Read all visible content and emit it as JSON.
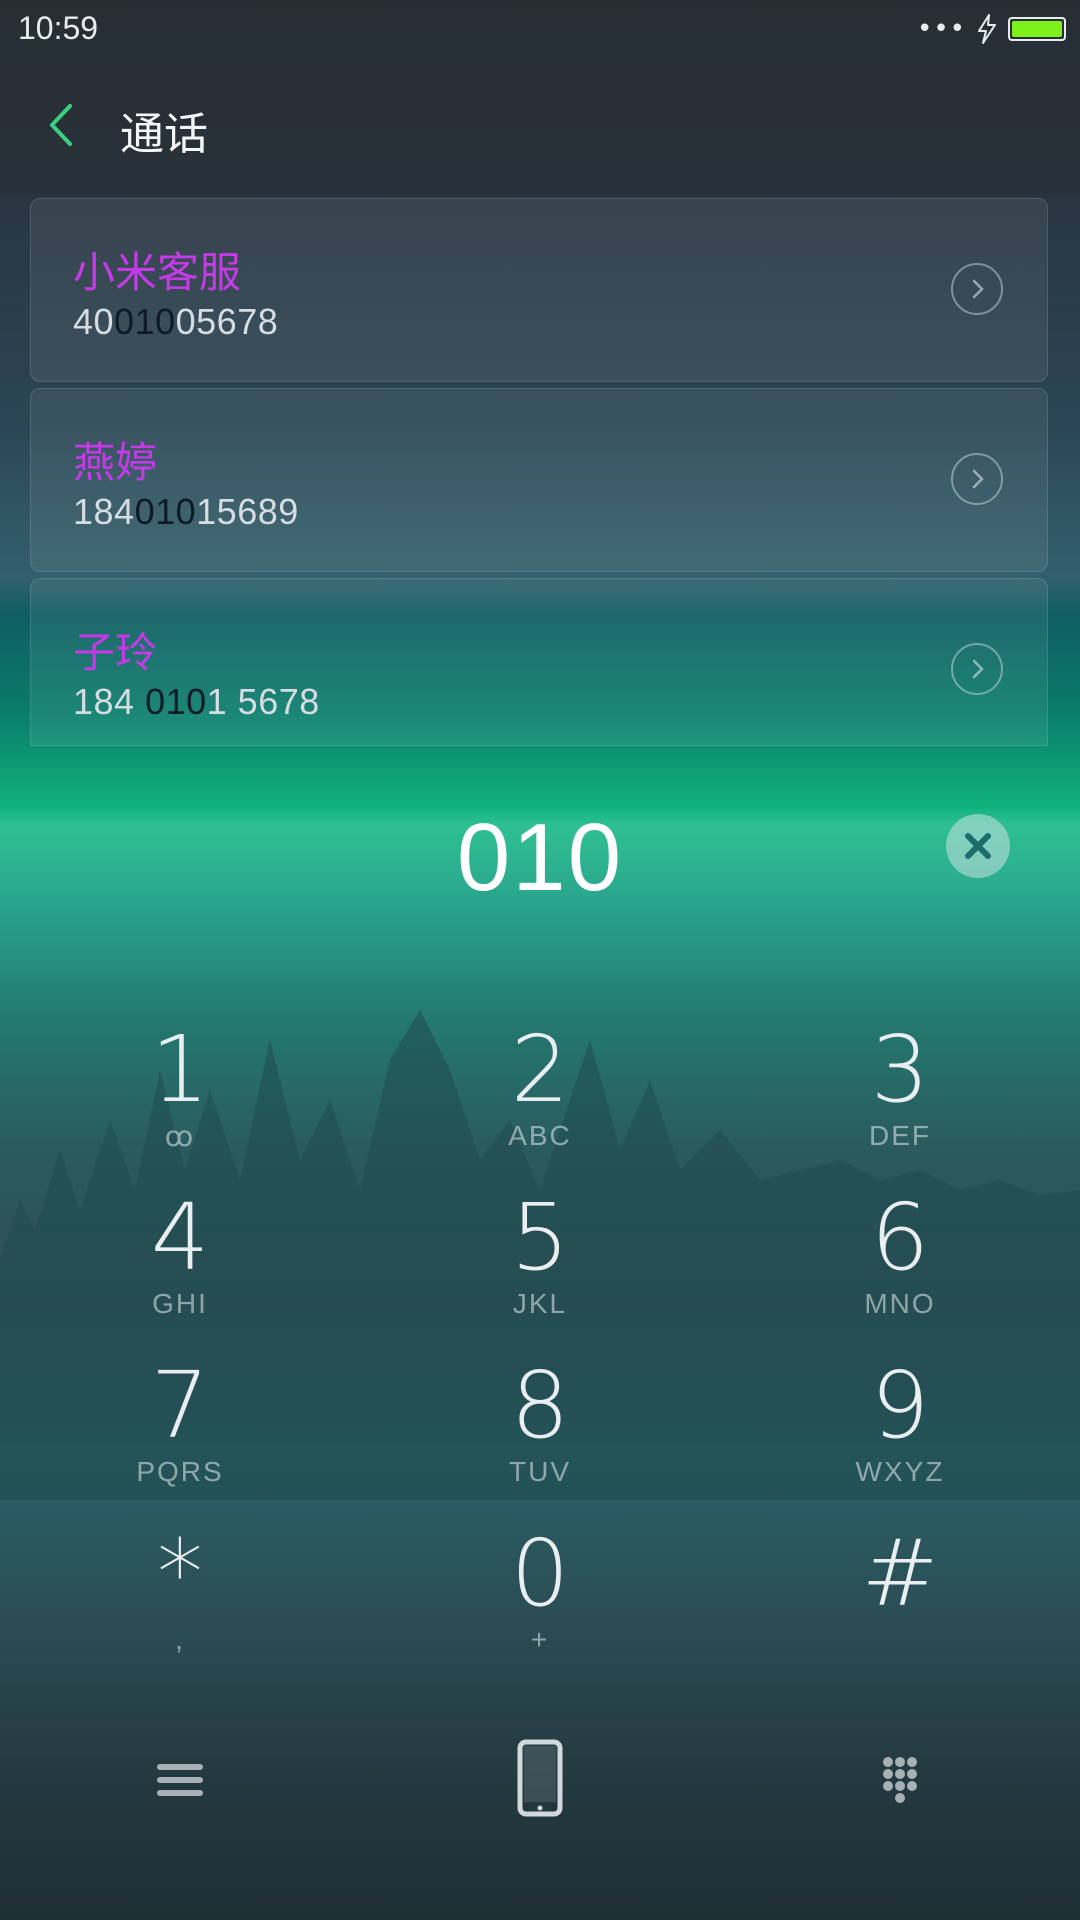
{
  "status_bar": {
    "time": "10:59",
    "signal_dots": "•••",
    "battery_color": "#7ff11a"
  },
  "header": {
    "title": "通话",
    "back_icon": "chevron-left-icon",
    "accent_color": "#3ad07f"
  },
  "contacts": [
    {
      "name": "小米客服",
      "number_pre": "40",
      "number_hl": "010",
      "number_post": "05678"
    },
    {
      "name": "燕婷",
      "number_pre": "184",
      "number_hl": "010",
      "number_post": "15689"
    },
    {
      "name": "子玲",
      "number_pre": "184 ",
      "number_hl": "010",
      "number_post": "1 5678"
    }
  ],
  "dial": {
    "value": "010",
    "clear_icon": "clear-x-icon"
  },
  "keypad": [
    {
      "digit": "1",
      "letters": "ꝏ"
    },
    {
      "digit": "2",
      "letters": "ABC"
    },
    {
      "digit": "3",
      "letters": "DEF"
    },
    {
      "digit": "4",
      "letters": "GHI"
    },
    {
      "digit": "5",
      "letters": "JKL"
    },
    {
      "digit": "6",
      "letters": "MNO"
    },
    {
      "digit": "7",
      "letters": "PQRS"
    },
    {
      "digit": "8",
      "letters": "TUV"
    },
    {
      "digit": "9",
      "letters": "WXYZ"
    },
    {
      "digit": "*",
      "letters": ","
    },
    {
      "digit": "0",
      "letters": "+"
    },
    {
      "digit": "#",
      "letters": ""
    }
  ],
  "bottom_nav": {
    "menu_icon": "menu-icon",
    "call_icon": "phone-icon",
    "keypad_icon": "dialpad-icon"
  },
  "colors": {
    "contact_name": "#c43ae6",
    "highlight": "#0d1a2a"
  }
}
